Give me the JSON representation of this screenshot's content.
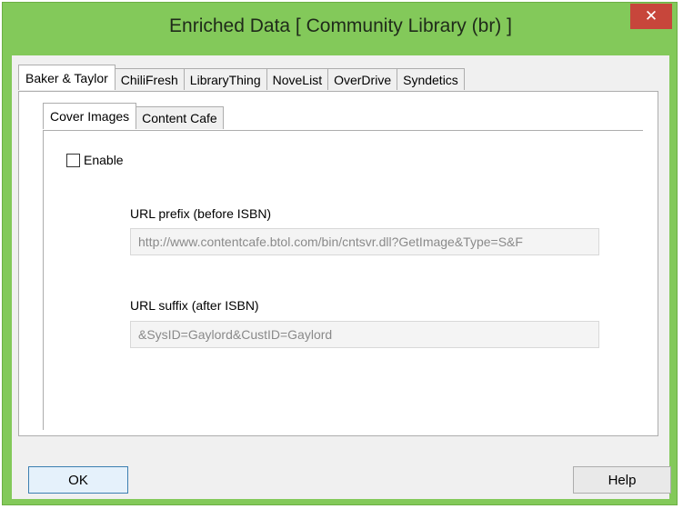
{
  "window": {
    "title": "Enriched Data [ Community Library  (br) ]",
    "close_label": "✕"
  },
  "tabs": [
    {
      "label": "Baker & Taylor",
      "active": true
    },
    {
      "label": "ChiliFresh"
    },
    {
      "label": "LibraryThing"
    },
    {
      "label": "NoveList"
    },
    {
      "label": "OverDrive"
    },
    {
      "label": "Syndetics"
    }
  ],
  "subtabs": [
    {
      "label": "Cover Images",
      "active": true
    },
    {
      "label": "Content Cafe"
    }
  ],
  "enable": {
    "label": "Enable",
    "checked": false
  },
  "url_prefix": {
    "label": "URL prefix (before ISBN)",
    "value": "http://www.contentcafe.btol.com/bin/cntsvr.dll?GetImage&Type=S&F"
  },
  "url_suffix": {
    "label": "URL suffix (after ISBN)",
    "value": "&SysID=Gaylord&CustID=Gaylord"
  },
  "buttons": {
    "ok": "OK",
    "help": "Help"
  }
}
